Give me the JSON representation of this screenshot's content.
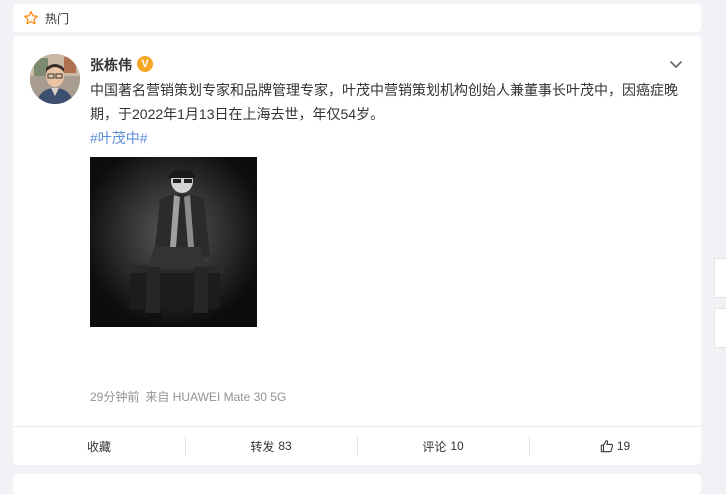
{
  "header": {
    "title": "热门"
  },
  "post": {
    "username": "张栋伟",
    "verified_badge": "V",
    "text": "中国著名营销策划专家和品牌管理专家，叶茂中营销策划机构创始人兼董事长叶茂中，因癌症晚期，于2022年1月13日在上海去世，年仅54岁。",
    "hashtag": "#叶茂中#",
    "time": "29分钟前",
    "source": "来自 HUAWEI Mate 30 5G"
  },
  "actions": {
    "favorite_label": "收藏",
    "repost_label": "转发",
    "repost_count": "83",
    "comment_label": "评论",
    "comment_count": "10",
    "like_count": "19"
  },
  "colors": {
    "accent_link": "#5b8cd8",
    "badge_orange": "#f5a623",
    "page_bg": "#f1f2f5"
  },
  "icons": [
    "star-icon",
    "chevron-down-icon",
    "thumbs-up-icon",
    "verified-icon"
  ]
}
